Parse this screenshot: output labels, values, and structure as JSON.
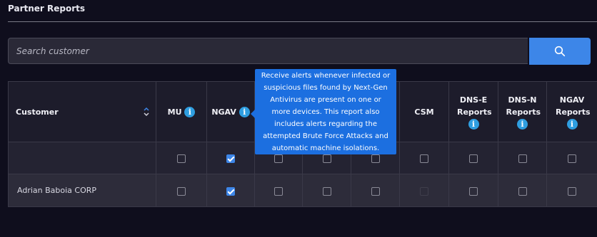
{
  "header": {
    "title": "Partner Reports"
  },
  "search": {
    "placeholder": "Search customer",
    "button_icon": "search-icon"
  },
  "table": {
    "columns": [
      {
        "label": "Customer",
        "sortable": true
      },
      {
        "label": "MU",
        "info": true
      },
      {
        "label": "NGAV",
        "info": true
      },
      {
        "label": "",
        "info": false
      },
      {
        "label": "",
        "info": false
      },
      {
        "label": "",
        "info": false
      },
      {
        "label": "CSM",
        "info": false
      },
      {
        "label": "DNS-E Reports",
        "info": true
      },
      {
        "label": "DNS-N Reports",
        "info": true
      },
      {
        "label": "NGAV Reports",
        "info": true
      }
    ],
    "filter_row": {
      "checked": [
        false,
        true,
        false,
        false,
        false,
        false,
        false,
        false,
        false
      ]
    },
    "rows": [
      {
        "customer": "Adrian Baboia CORP",
        "checked": [
          false,
          true,
          false,
          false,
          false,
          null,
          false,
          false,
          false
        ]
      }
    ]
  },
  "tooltip": {
    "text": "Receive alerts whenever infected or suspicious files found by Next-Gen Antivirus are present on one or more devices. This report also includes alerts regarding the attempted Brute Force Attacks and automatic machine isolations."
  },
  "colors": {
    "accent": "#3d86e8",
    "info": "#2f9ee0",
    "tooltip": "#1c6fe0",
    "background": "#0f0e1d"
  }
}
